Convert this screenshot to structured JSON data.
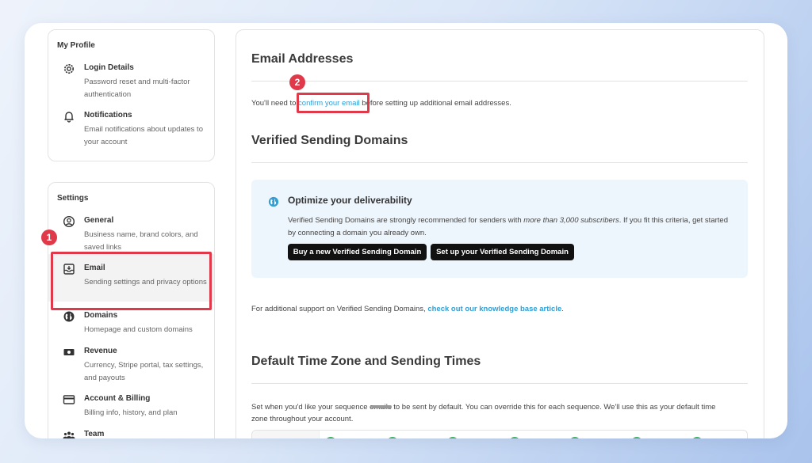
{
  "profile": {
    "title": "My Profile",
    "items": [
      {
        "label": "Login Details",
        "desc": "Password reset and multi-factor authentication",
        "icon": "gear-icon"
      },
      {
        "label": "Notifications",
        "desc": "Email notifications about updates to your account",
        "icon": "bell-icon"
      }
    ]
  },
  "settings": {
    "title": "Settings",
    "items": [
      {
        "label": "General",
        "desc": "Business name, brand colors, and saved links",
        "icon": "user-circle-icon"
      },
      {
        "label": "Email",
        "desc": "Sending settings and privacy options",
        "icon": "inbox-icon",
        "active": true
      },
      {
        "label": "Domains",
        "desc": "Homepage and custom domains",
        "icon": "globe-icon"
      },
      {
        "label": "Revenue",
        "desc": "Currency, Stripe portal, tax settings, and payouts",
        "icon": "money-icon"
      },
      {
        "label": "Account & Billing",
        "desc": "Billing info, history, and plan",
        "icon": "credit-card-icon"
      },
      {
        "label": "Team",
        "desc": "",
        "icon": "team-icon"
      }
    ]
  },
  "email_addresses": {
    "heading": "Email Addresses",
    "text_before": "You'll need to ",
    "link": "confirm your email",
    "text_after": " before setting up additional email addresses."
  },
  "domains": {
    "heading": "Verified Sending Domains",
    "callout_title": "Optimize your deliverability",
    "callout_body_1": "Verified Sending Domains are strongly recommended for senders with ",
    "callout_body_em": "more than 3,000 subscribers",
    "callout_body_2": ". If you fit this criteria, get started by connecting a domain you already own.",
    "button_buy": "Buy a new Verified Sending Domain",
    "button_setup": "Set up your Verified Sending Domain",
    "support_text": "For additional support on Verified Sending Domains, ",
    "support_link": "check out our knowledge base article",
    "support_end": "."
  },
  "timezone": {
    "heading": "Default Time Zone and Sending Times",
    "desc_line1": "Set when you'd like your sequence emails to be sent by default. You can override this for each sequence. We'll use this as your default time",
    "desc_line2": "zone throughout your account."
  },
  "annotations": {
    "badge_1": "1",
    "badge_2": "2",
    "color": "#e03a4a"
  },
  "colors": {
    "accent_link": "#2f9fd6",
    "button_bg": "#111111",
    "callout_bg": "#eef6fd",
    "toggle_on": "#3bb55b"
  }
}
